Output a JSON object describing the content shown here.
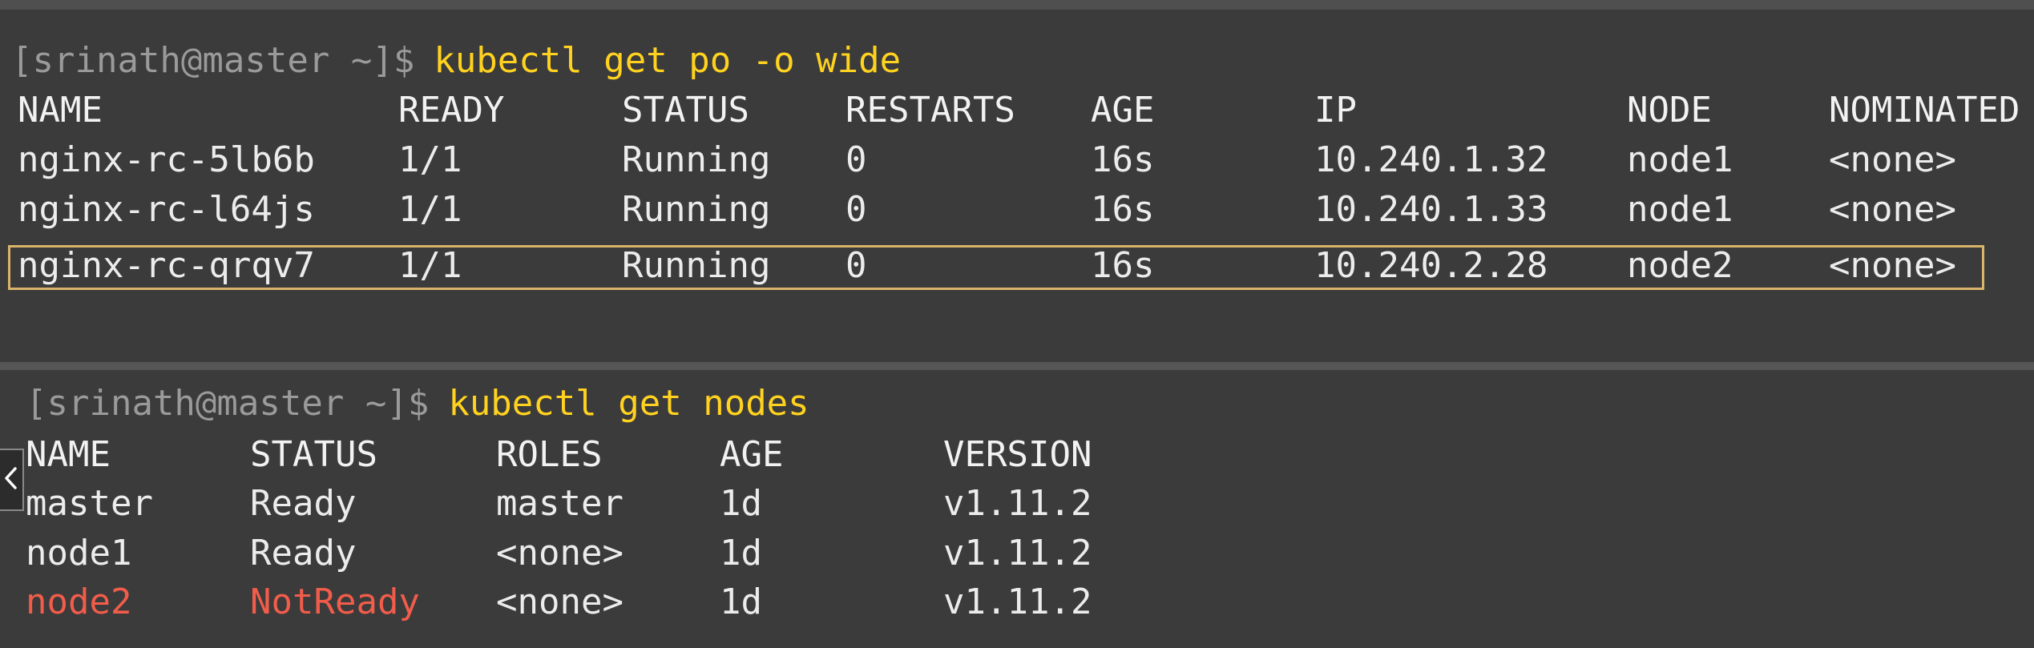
{
  "terminal_top": {
    "prompt": "[srinath@master ~]$",
    "command": "kubectl get po -o wide",
    "headers": [
      "NAME",
      "READY",
      "STATUS",
      "RESTARTS",
      "AGE",
      "IP",
      "NODE",
      "NOMINATED"
    ],
    "rows": [
      [
        "nginx-rc-5lb6b",
        "1/1",
        "Running",
        "0",
        "16s",
        "10.240.1.32",
        "node1",
        "<none>"
      ],
      [
        "nginx-rc-l64js",
        "1/1",
        "Running",
        "0",
        "16s",
        "10.240.1.33",
        "node1",
        "<none>"
      ],
      [
        "nginx-rc-qrqv7",
        "1/1",
        "Running",
        "0",
        "16s",
        "10.240.2.28",
        "node2",
        "<none>"
      ]
    ],
    "highlighted_row": 2
  },
  "terminal_bottom": {
    "prompt": "[srinath@master ~]$",
    "command": "kubectl get nodes",
    "headers": [
      "NAME",
      "STATUS",
      "ROLES",
      "AGE",
      "VERSION"
    ],
    "rows": [
      [
        "master",
        "Ready",
        "master",
        "1d",
        "v1.11.2"
      ],
      [
        "node1",
        "Ready",
        "<none>",
        "1d",
        "v1.11.2"
      ],
      [
        "node2",
        "NotReady",
        "<none>",
        "1d",
        "v1.11.2"
      ]
    ],
    "alert_row": 2
  },
  "side_tab": {
    "icon": "chevron-left-icon"
  },
  "colors": {
    "background": "#3b3b3b",
    "prompt": "#9a9a9a",
    "command": "#ffd21f",
    "text": "#ececec",
    "alert": "#f25c4a",
    "highlight_border": "#d9b46a"
  }
}
